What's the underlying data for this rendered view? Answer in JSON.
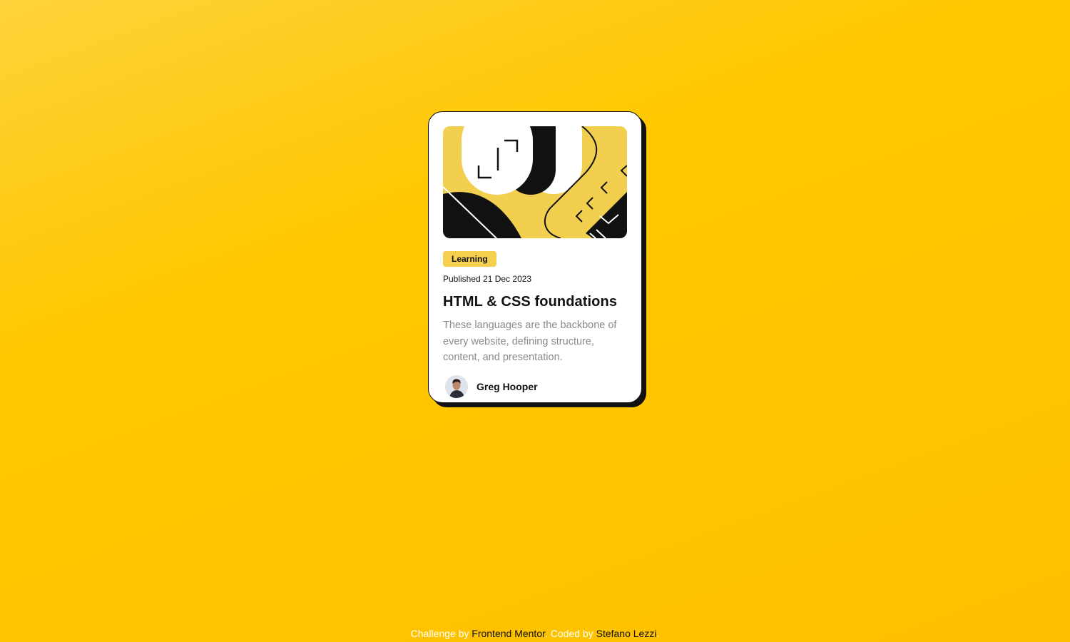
{
  "card": {
    "tag": "Learning",
    "published": "Published 21 Dec 2023",
    "title": "HTML & CSS foundations",
    "description": "These languages are the backbone of every website, defining structure, content, and presentation.",
    "author": "Greg Hooper"
  },
  "footer": {
    "prefix": "Challenge by ",
    "link1": "Frontend Mentor",
    "mid": ". Coded by ",
    "link2": "Stefano Lezzi",
    "suffix": "."
  },
  "colors": {
    "background": "#ffc800",
    "accent": "#f4d04e",
    "text": "#111111",
    "muted": "#8a8a8a"
  }
}
